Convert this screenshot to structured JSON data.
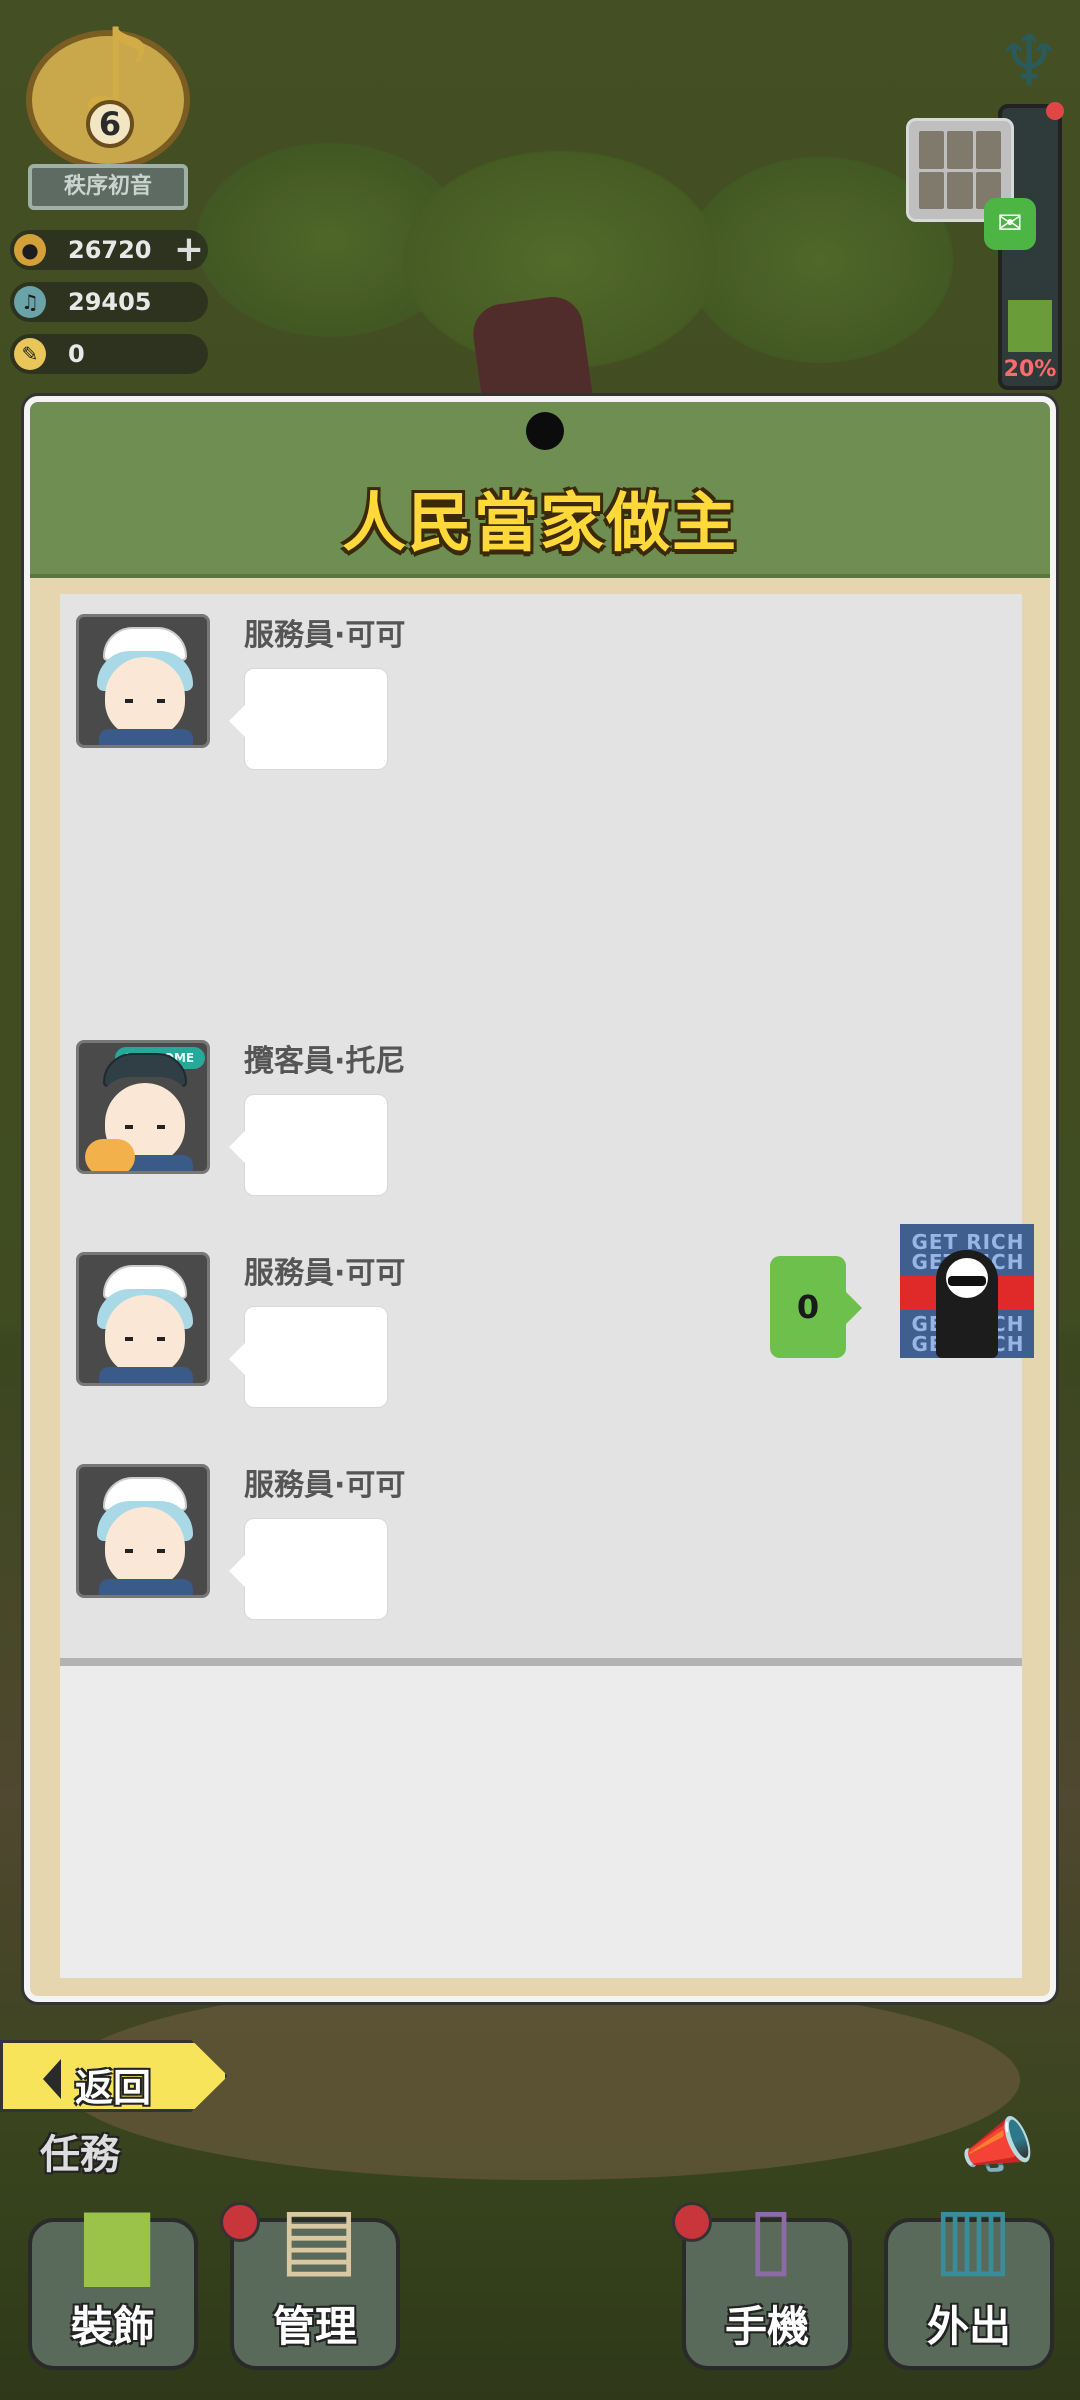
{
  "hud": {
    "level": "6",
    "rank": "秩序初音",
    "coins": "26720",
    "notes": "29405",
    "tickets": "0",
    "power_percent": "20%"
  },
  "panel": {
    "title": "人民當家做主"
  },
  "messages": [
    {
      "sender": "服務員·可可",
      "text": ""
    },
    {
      "sender": "攬客員·托尼",
      "text": ""
    },
    {
      "sender": "服務員·可可",
      "text": ""
    },
    {
      "sender": "服務員·可可",
      "text": ""
    }
  ],
  "my_message": {
    "text": "0",
    "avatar_text": [
      "GET RICH",
      "GET RICH",
      "GET RICH",
      "GET RICH"
    ]
  },
  "avatar_badge": "WELCOME",
  "bottom": {
    "back_label": "返回",
    "task_label": "任務",
    "nav": [
      {
        "label": "裝飾",
        "icon": "paint-roller-icon"
      },
      {
        "label": "管理",
        "icon": "clipboard-icon"
      },
      {
        "label": "手機",
        "icon": "phone-icon"
      },
      {
        "label": "外出",
        "icon": "city-icon"
      }
    ]
  },
  "colors": {
    "header_green": "#6e8f51",
    "title_yellow": "#ffd93a",
    "my_bubble_green": "#6dc04b",
    "back_button_yellow": "#f7e45a"
  }
}
